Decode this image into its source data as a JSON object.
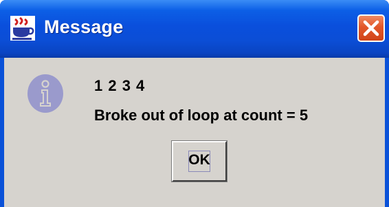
{
  "window": {
    "title": "Message",
    "title_icon": "java-coffee-cup-icon",
    "close_icon": "close-icon"
  },
  "dialog": {
    "icon": "info-icon",
    "lines": [
      "1 2 3 4",
      "Broke out of loop at count = 5"
    ],
    "ok_label": "OK"
  },
  "colors": {
    "titlebar_blue": "#0a4fdc",
    "close_red": "#e2572a",
    "dialog_background": "#d6d3ce",
    "info_icon_fill": "#9a9acc"
  }
}
